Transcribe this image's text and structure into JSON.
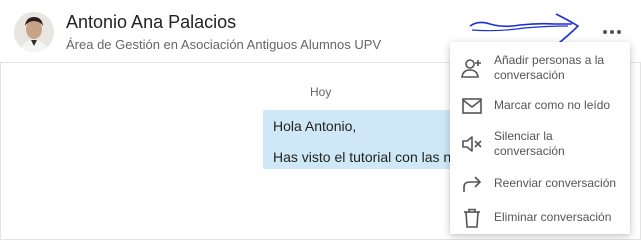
{
  "header": {
    "name": "Antonio Ana Palacios",
    "subtitle": "Área de Gestión en Asociación Antiguos Alumnos UPV",
    "more_icon": "more-horizontal-icon"
  },
  "conversation": {
    "day_label": "Hoy",
    "message_lines": [
      "Hola Antonio,",
      "Has visto el tutorial con las n"
    ]
  },
  "menu": {
    "items": [
      {
        "label": "Añadir personas a la conversación",
        "icon": "add-person-icon"
      },
      {
        "label": "Marcar como no leído",
        "icon": "envelope-icon"
      },
      {
        "label": "Silenciar la conversación",
        "icon": "mute-icon"
      },
      {
        "label": "Reenviar conversación",
        "icon": "forward-arrow-icon"
      },
      {
        "label": "Eliminar conversación",
        "icon": "trash-icon"
      }
    ]
  },
  "colors": {
    "bubble": "#cfe8f7",
    "annotation_arrow": "#1a2fd6"
  }
}
